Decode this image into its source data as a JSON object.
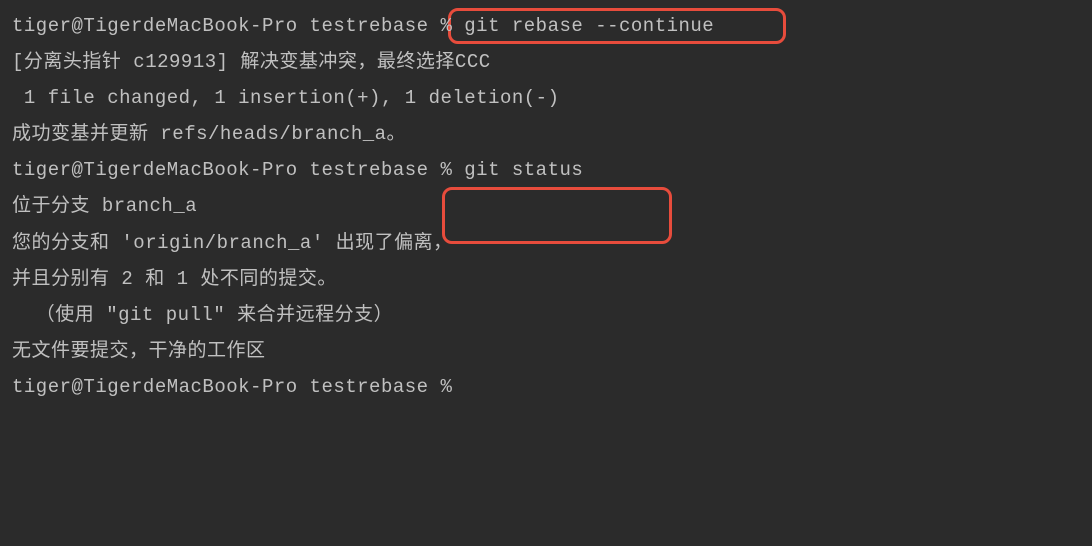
{
  "terminal": {
    "prompt": "tiger@TigerdeMacBook-Pro testrebase % ",
    "lines": [
      {
        "text": "tiger@TigerdeMacBook-Pro testrebase % git rebase --continue"
      },
      {
        "text": "[分离头指针 c129913] 解决变基冲突，最终选择CCC"
      },
      {
        "text": " 1 file changed, 1 insertion(+), 1 deletion(-)"
      },
      {
        "text": "成功变基并更新 refs/heads/branch_a。"
      },
      {
        "text": "tiger@TigerdeMacBook-Pro testrebase % git status"
      },
      {
        "text": "位于分支 branch_a"
      },
      {
        "text": "您的分支和 'origin/branch_a' 出现了偏离，"
      },
      {
        "text": "并且分别有 2 和 1 处不同的提交。"
      },
      {
        "text": "  （使用 \"git pull\" 来合并远程分支）"
      },
      {
        "text": ""
      },
      {
        "text": "无文件要提交，干净的工作区"
      },
      {
        "text": "tiger@TigerdeMacBook-Pro testrebase % "
      }
    ],
    "commands": {
      "rebase": "git rebase --continue",
      "status": "git status"
    },
    "highlights": [
      {
        "command": "git rebase --continue",
        "line": 0
      },
      {
        "command": "git status",
        "line": 4
      }
    ]
  }
}
